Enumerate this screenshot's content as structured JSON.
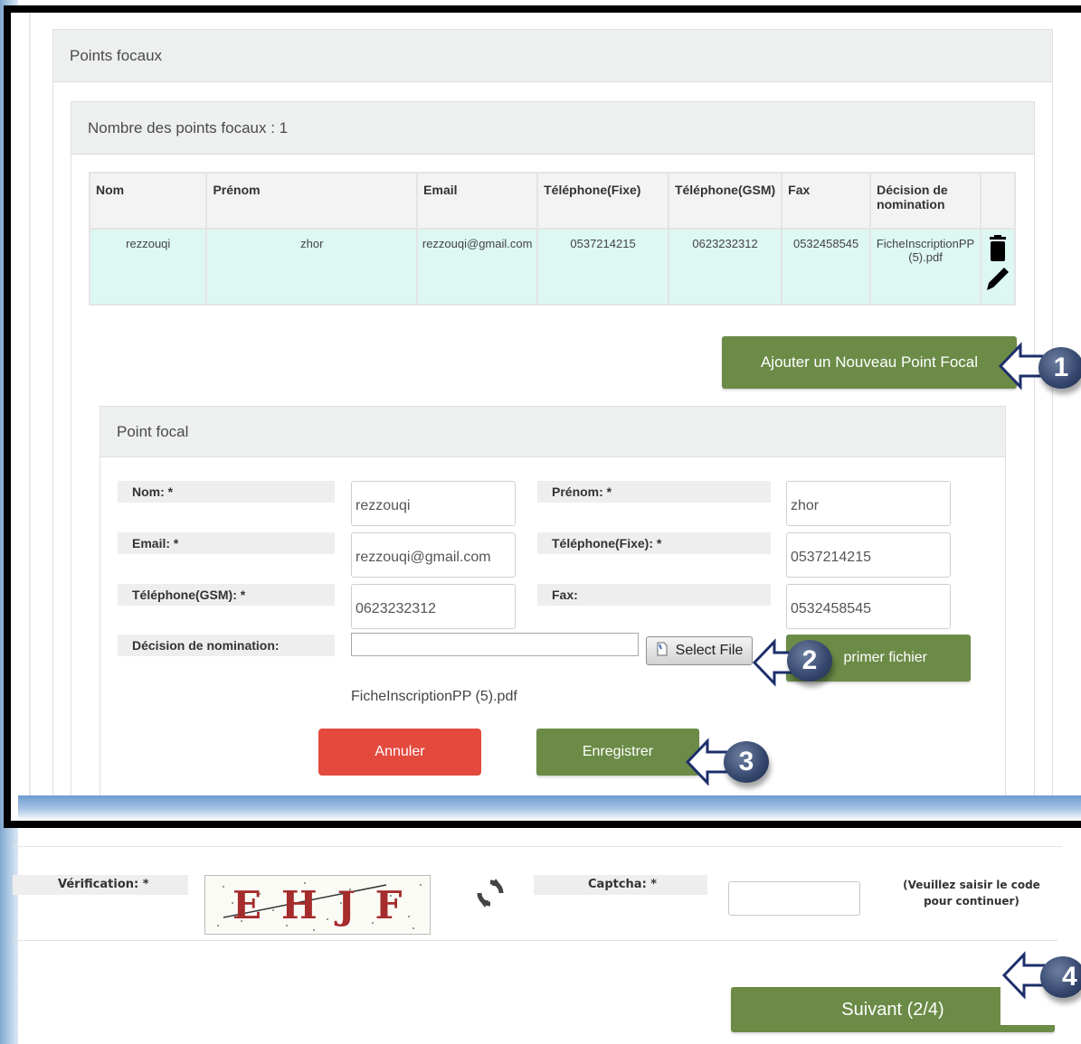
{
  "points_focaux_title": "Points focaux",
  "count_header": "Nombre des points focaux : 1",
  "table": {
    "headers": [
      "Nom",
      "Prénom",
      "Email",
      "Téléphone(Fixe)",
      "Téléphone(GSM)",
      "Fax",
      "Décision de nomination"
    ],
    "row": {
      "nom": "rezzouqi",
      "prenom": "zhor",
      "email": "rezzouqi@gmail.com",
      "tel_fixe": "0537214215",
      "tel_gsm": "0623232312",
      "fax": "0532458545",
      "decision": "FicheInscriptionPP (5).pdf"
    }
  },
  "add_button": "Ajouter un Nouveau Point Focal",
  "form": {
    "title": "Point focal",
    "nom_label": "Nom: *",
    "nom_value": "rezzouqi",
    "prenom_label": "Prénom: *",
    "prenom_value": "zhor",
    "email_label": "Email: *",
    "email_value": "rezzouqi@gmail.com",
    "tel_fixe_label": "Téléphone(Fixe): *",
    "tel_fixe_value": "0537214215",
    "tel_gsm_label": "Téléphone(GSM): *",
    "tel_gsm_value": "0623232312",
    "fax_label": "Fax:",
    "fax_value": "0532458545",
    "decision_label": "Décision de nomination:",
    "select_file": "Select File",
    "delete_file": "primer fichier",
    "file_name": "FicheInscriptionPP (5).pdf",
    "cancel": "Annuler",
    "save": "Enregistrer"
  },
  "verification": {
    "label": "Vérification: *",
    "captcha_image_text": "EHJF",
    "captcha_label": "Captcha: *",
    "captcha_value": "",
    "hint": "(Veuillez saisir le code pour continuer)"
  },
  "next_button": "Suivant (2/4)",
  "callouts": [
    "1",
    "2",
    "3",
    "4"
  ],
  "colors": {
    "green": "#6b8b47",
    "red": "#e4493e",
    "row_bg": "#ddf7f3",
    "callout": "#33456b"
  },
  "icons": [
    "trash-icon",
    "pencil-icon",
    "file-icon",
    "refresh-icon",
    "arrow-left-icon"
  ]
}
